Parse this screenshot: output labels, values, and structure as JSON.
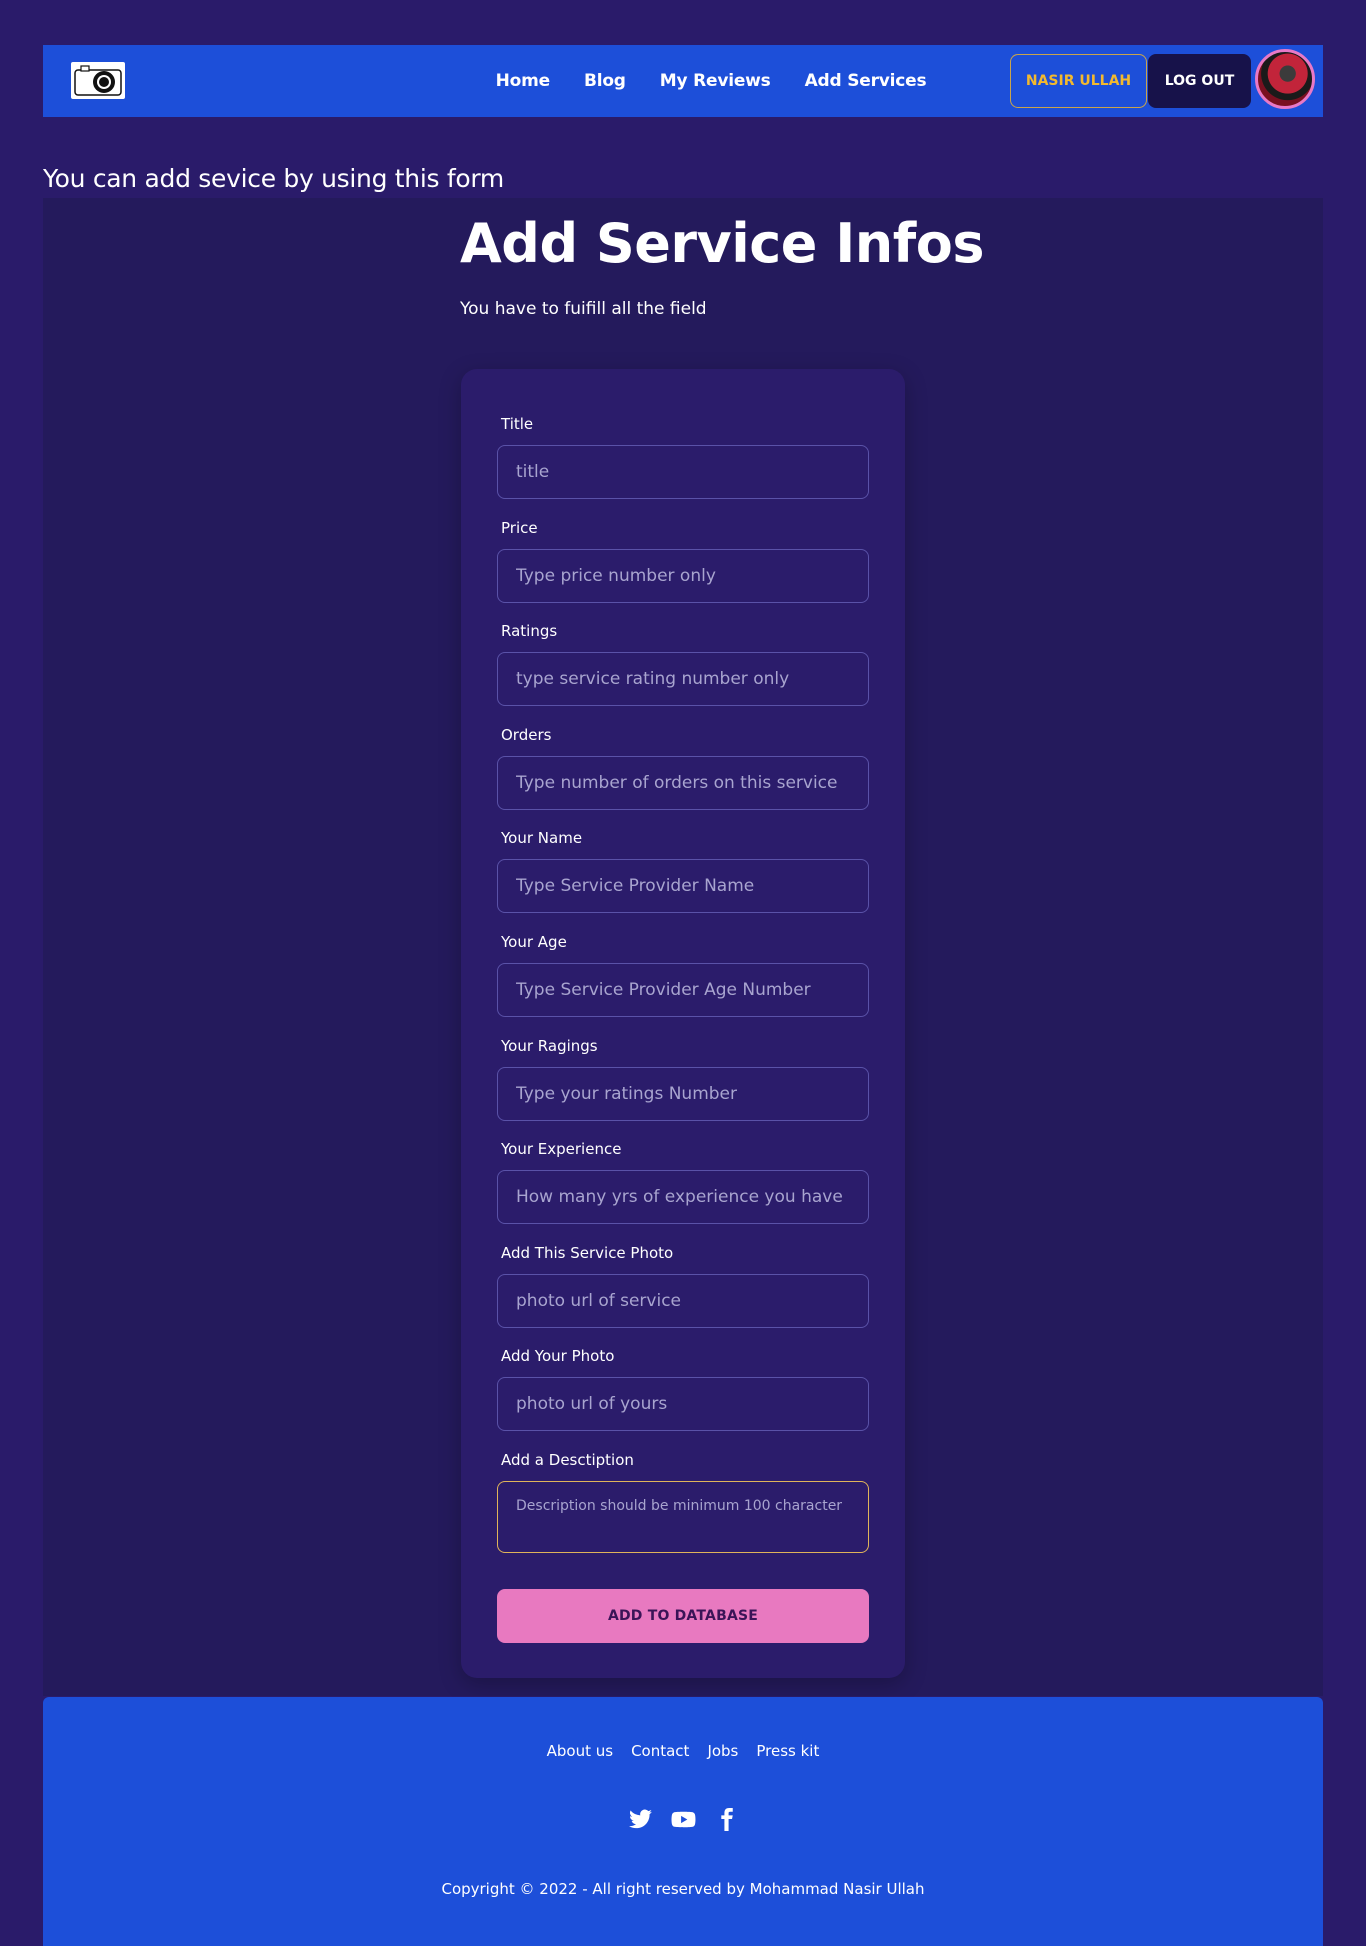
{
  "nav": {
    "links": [
      "Home",
      "Blog",
      "My Reviews",
      "Add Services"
    ],
    "user_label": "NASIR ULLAH",
    "logout_label": "LOG OUT"
  },
  "intro_text": "You can add sevice by using this form",
  "hero": {
    "title": "Add Service Infos",
    "subtitle": "You have to fuifill all the field"
  },
  "form": {
    "fields": [
      {
        "label": "Title",
        "placeholder": "title"
      },
      {
        "label": "Price",
        "placeholder": "Type price number only"
      },
      {
        "label": "Ratings",
        "placeholder": "type service rating number only"
      },
      {
        "label": "Orders",
        "placeholder": "Type number of orders on this service"
      },
      {
        "label": "Your Name",
        "placeholder": "Type Service Provider Name"
      },
      {
        "label": "Your Age",
        "placeholder": "Type Service Provider Age Number"
      },
      {
        "label": "Your Ragings",
        "placeholder": "Type your ratings Number"
      },
      {
        "label": "Your Experience",
        "placeholder": "How many yrs of experience you have"
      },
      {
        "label": "Add This Service Photo",
        "placeholder": "photo url of service"
      },
      {
        "label": "Add Your Photo",
        "placeholder": "photo url of yours"
      }
    ],
    "description": {
      "label": "Add a Desctiption",
      "placeholder": "Description should be minimum 100 character"
    },
    "submit_label": "ADD TO DATABASE"
  },
  "footer": {
    "links": [
      "About us",
      "Contact",
      "Jobs",
      "Press kit"
    ],
    "socials": [
      "twitter-icon",
      "youtube-icon",
      "facebook-icon"
    ],
    "copyright": "Copyright © 2022 - All right reserved by Mohammad Nasir Ullah"
  },
  "colors": {
    "background": "#2a1b6a",
    "panel": "#241a5c",
    "navbar": "#1d4fd9",
    "accent_button": "#e879c0",
    "user_button_text": "#f3b92e"
  }
}
